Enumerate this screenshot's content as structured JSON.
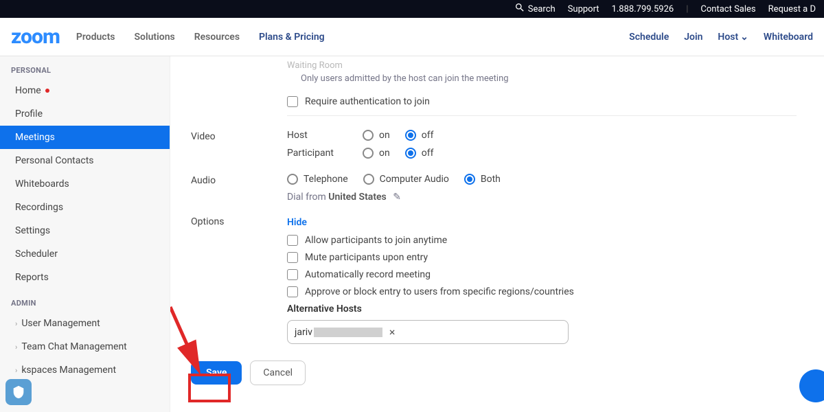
{
  "topbar": {
    "search": "Search",
    "support": "Support",
    "phone": "1.888.799.5926",
    "contact_sales": "Contact Sales",
    "request_demo": "Request a D"
  },
  "mainnav": {
    "logo": "zoom",
    "products": "Products",
    "solutions": "Solutions",
    "resources": "Resources",
    "plans": "Plans & Pricing",
    "schedule": "Schedule",
    "join": "Join",
    "host": "Host",
    "whiteboard": "Whiteboard"
  },
  "sidebar": {
    "personal_label": "PERSONAL",
    "admin_label": "ADMIN",
    "items": {
      "home": "Home",
      "profile": "Profile",
      "meetings": "Meetings",
      "contacts": "Personal Contacts",
      "whiteboards": "Whiteboards",
      "recordings": "Recordings",
      "settings": "Settings",
      "scheduler": "Scheduler",
      "reports": "Reports",
      "user_mgmt": "User Management",
      "team_chat": "Team Chat Management",
      "workspaces": "kspaces Management"
    }
  },
  "form": {
    "faded_line1": "Waiting Room",
    "sub_line1": "Only users admitted by the host can join the meeting",
    "require_auth": "Require authentication to join",
    "video_label": "Video",
    "host_label": "Host",
    "participant_label": "Participant",
    "on": "on",
    "off": "off",
    "audio_label": "Audio",
    "telephone": "Telephone",
    "computer_audio": "Computer Audio",
    "both": "Both",
    "dial_from": "Dial from ",
    "dial_country": "United States",
    "options_label": "Options",
    "hide": "Hide",
    "opt_anytime": "Allow participants to join anytime",
    "opt_mute": "Mute participants upon entry",
    "opt_record": "Automatically record meeting",
    "opt_regions": "Approve or block entry to users from specific regions/countries",
    "alt_hosts_label": "Alternative Hosts",
    "alt_host_value": "jariv",
    "save": "Save",
    "cancel": "Cancel"
  }
}
